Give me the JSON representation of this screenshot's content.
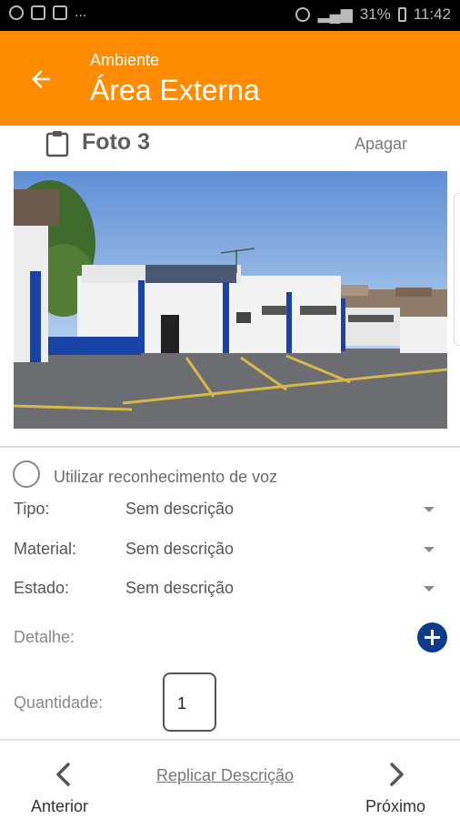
{
  "status_bar": {
    "icons_left": [
      "alarm-clock-icon",
      "image-icon",
      "gmail-icon"
    ],
    "more": "...",
    "battery": "31%",
    "time": "11:42"
  },
  "header": {
    "subtitle": "Ambiente",
    "title": "Área Externa",
    "background": "#ff8c00"
  },
  "photo": {
    "title": "Foto 3",
    "delete_label": "Apagar"
  },
  "voice": {
    "label": "Utilizar reconhecimento de voz"
  },
  "fields": [
    {
      "label": "Tipo:",
      "value": "Sem descrição"
    },
    {
      "label": "Material:",
      "value": "Sem descrição"
    },
    {
      "label": "Estado:",
      "value": "Sem descrição"
    }
  ],
  "detalhe": {
    "label": "Detalhe:"
  },
  "quantidade": {
    "label": "Quantidade:",
    "value": "1"
  },
  "bottom_nav": {
    "prev_label": "Anterior",
    "replicate_label": "Replicar Descrição",
    "next_label": "Próximo"
  },
  "colors": {
    "accent": "#ff8c00",
    "add_button": "#0d3a8c"
  }
}
